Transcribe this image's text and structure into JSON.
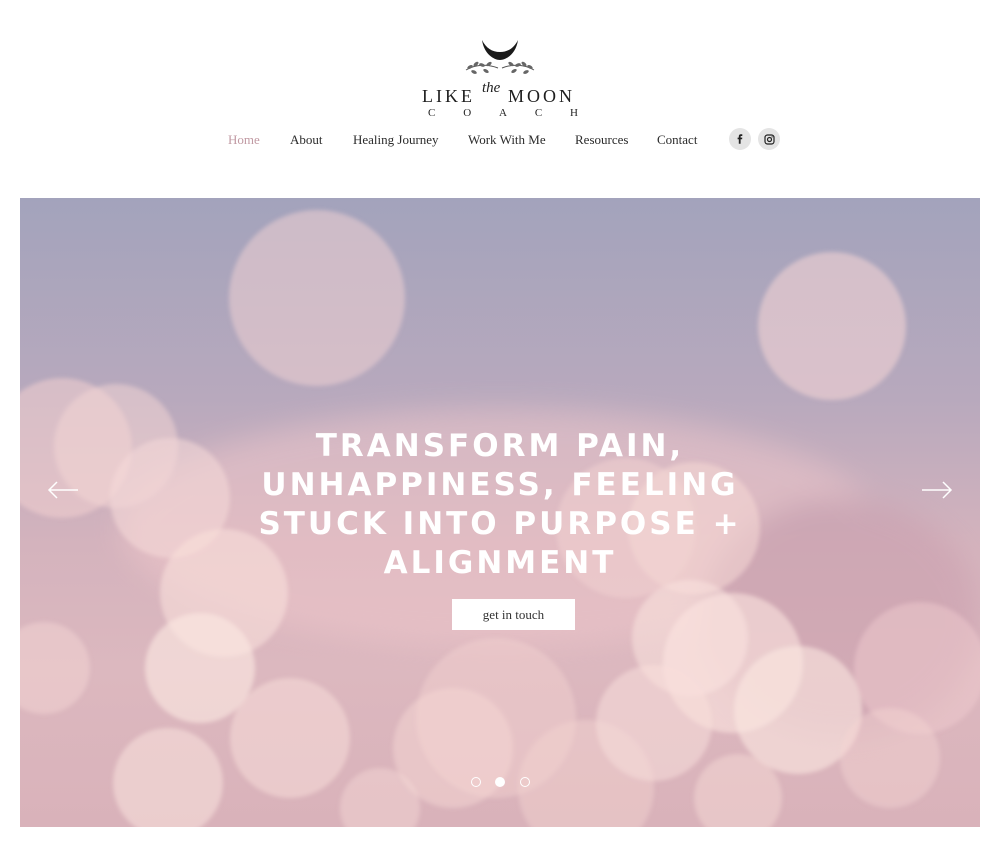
{
  "logo": {
    "word_left": "LIKE",
    "word_the": "the",
    "word_right": "MOON",
    "subtitle_letters": [
      "C",
      "O",
      "A",
      "C",
      "H"
    ],
    "icon": "crescent-moon-with-olive-branches"
  },
  "nav": {
    "items": [
      {
        "label": "Home",
        "active": true
      },
      {
        "label": "About",
        "active": false
      },
      {
        "label": "Healing Journey",
        "active": false
      },
      {
        "label": "Work With Me",
        "active": false
      },
      {
        "label": "Resources",
        "active": false
      },
      {
        "label": "Contact",
        "active": false
      }
    ],
    "social": [
      {
        "icon": "facebook-icon"
      },
      {
        "icon": "instagram-icon"
      }
    ]
  },
  "hero": {
    "title": "TRANSFORM PAIN, UNHAPPINESS, FEELING STUCK INTO PURPOSE + ALIGNMENT",
    "cta_label": "get in touch",
    "prev_icon": "arrow-left-icon",
    "next_icon": "arrow-right-icon",
    "slide_count": 3,
    "active_slide": 2
  },
  "colors": {
    "nav_active": "#c19aa3",
    "nav_text": "#2b2b2b",
    "hero_top": "#a3a3bc",
    "hero_bottom": "#d9b2ba",
    "cta_background": "#ffffff",
    "title_text": "#ffffff"
  }
}
